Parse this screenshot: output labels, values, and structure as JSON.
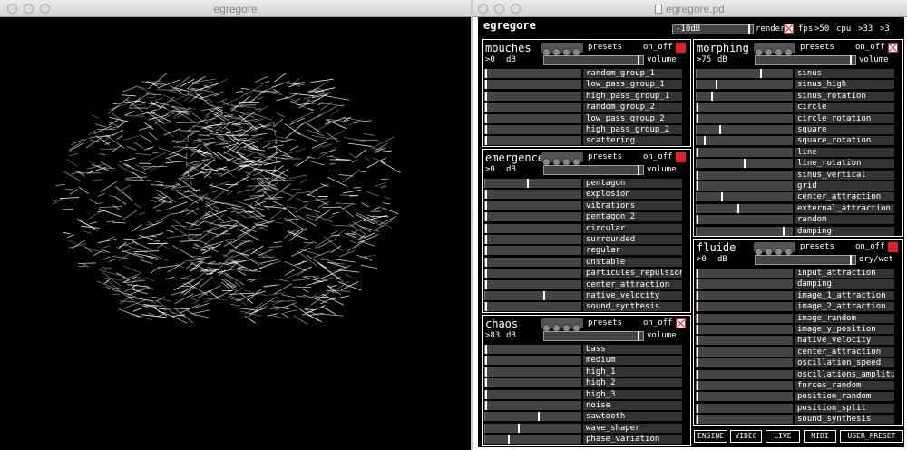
{
  "viz_window": {
    "title": "egregore"
  },
  "patch_window": {
    "title": "egregore.pd"
  },
  "app": {
    "title": "egregore"
  },
  "master": {
    "level_label": "-10dB",
    "render_label": "render",
    "fps_label": "fps",
    "fps_value": "50",
    "cpu_label": "cpu",
    "cpu_value": "33",
    "extra_value": "3"
  },
  "common": {
    "presets": "presets",
    "on_off": "on_off",
    "db": "dB",
    "volume": "volume",
    "dry_wet": "dry/wet"
  },
  "mouches": {
    "title": "mouches",
    "db_value": "0",
    "level": 0.0,
    "rows": [
      {
        "label": "random_group_1",
        "value": 0.0
      },
      {
        "label": "low_pass_group_1",
        "value": 0.0
      },
      {
        "label": "high_pass_group_1",
        "value": 0.0
      },
      {
        "label": "random_group_2",
        "value": 0.0
      },
      {
        "label": "low_pass_group_2",
        "value": 0.0
      },
      {
        "label": "high_pass_group_2",
        "value": 0.0
      },
      {
        "label": "scattering",
        "value": 0.0
      }
    ]
  },
  "emergence": {
    "title": "emergence",
    "db_value": "0",
    "level": 0.0,
    "rows": [
      {
        "label": "pentagon",
        "value": 0.45
      },
      {
        "label": "explosion",
        "value": 0.0
      },
      {
        "label": "vibrations",
        "value": 0.0
      },
      {
        "label": "pentagon_2",
        "value": 0.0
      },
      {
        "label": "circular",
        "value": 0.0
      },
      {
        "label": "surrounded",
        "value": 0.0
      },
      {
        "label": "regular",
        "value": 0.0
      },
      {
        "label": "unstable",
        "value": 0.0
      },
      {
        "label": "particules_repulsion",
        "value": 0.0
      },
      {
        "label": "center_attraction",
        "value": 0.0
      },
      {
        "label": "native_velocity",
        "value": 0.62
      },
      {
        "label": "sound_synthesis",
        "value": 0.0
      }
    ]
  },
  "chaos": {
    "title": "chaos",
    "db_value": "83",
    "level": 0.0,
    "rows": [
      {
        "label": "bass",
        "value": 0.0
      },
      {
        "label": "medium",
        "value": 0.0
      },
      {
        "label": "high_1",
        "value": 0.0
      },
      {
        "label": "high_2",
        "value": 0.0
      },
      {
        "label": "high_3",
        "value": 0.0
      },
      {
        "label": "noise",
        "value": 0.0
      },
      {
        "label": "sawtooth",
        "value": 0.56
      },
      {
        "label": "wave_shaper",
        "value": 0.35
      },
      {
        "label": "phase_variation",
        "value": 0.24
      }
    ]
  },
  "morphing": {
    "title": "morphing",
    "db_value": "75",
    "level": 0.0,
    "rows": [
      {
        "label": "sinus",
        "value": 0.68
      },
      {
        "label": "sinus_high",
        "value": 0.2
      },
      {
        "label": "sinus_rotation",
        "value": 0.16
      },
      {
        "label": "circle",
        "value": 0.0
      },
      {
        "label": "circle_rotation",
        "value": 0.0
      },
      {
        "label": "square",
        "value": 0.24
      },
      {
        "label": "square_rotation",
        "value": 0.08
      },
      {
        "label": "line",
        "value": 0.0
      },
      {
        "label": "line_rotation",
        "value": 0.5
      },
      {
        "label": "sinus_vertical",
        "value": 0.0
      },
      {
        "label": "grid",
        "value": 0.0
      },
      {
        "label": "center_attraction",
        "value": 0.26
      },
      {
        "label": "external_attraction",
        "value": 0.44
      },
      {
        "label": "random",
        "value": 0.0
      },
      {
        "label": "damping",
        "value": 0.92
      }
    ]
  },
  "fluide": {
    "title": "fluide",
    "db_value": "0",
    "level": 0.0,
    "rows": [
      {
        "label": "input_attraction",
        "value": 0.0
      },
      {
        "label": "damping",
        "value": 0.0
      },
      {
        "label": "image_1_attraction",
        "value": 0.0
      },
      {
        "label": "image_2_attraction",
        "value": 0.0
      },
      {
        "label": "image_random",
        "value": 0.0
      },
      {
        "label": "image_y_position",
        "value": 0.0
      },
      {
        "label": "native_velocity",
        "value": 0.0
      },
      {
        "label": "center_attraction",
        "value": 0.0
      },
      {
        "label": "oscillation_speed",
        "value": 0.0
      },
      {
        "label": "oscillations_amplitude",
        "value": 0.0
      },
      {
        "label": "forces_random",
        "value": 0.0
      },
      {
        "label": "position_random",
        "value": 0.0
      },
      {
        "label": "position_split",
        "value": 0.0
      },
      {
        "label": "sound_synthesis",
        "value": 0.0
      }
    ]
  },
  "buttons": {
    "engine": "ENGINE",
    "video": "VIDEO",
    "live": "LIVE",
    "midi": "MIDI",
    "user_preset": "USER_PRESET"
  }
}
